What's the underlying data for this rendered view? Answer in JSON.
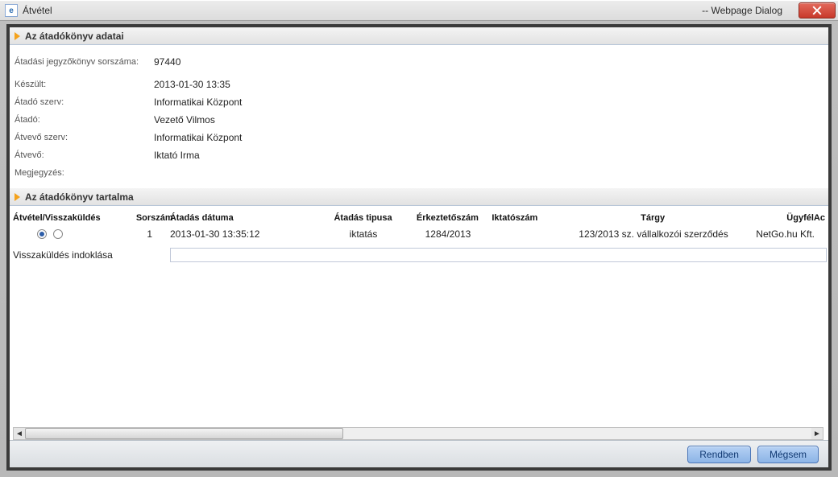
{
  "window": {
    "title": "Átvétel",
    "dialog_suffix": "-- Webpage Dialog"
  },
  "sections": {
    "head1": "Az átadókönyv adatai",
    "head2": "Az átadókönyv tartalma"
  },
  "fields": {
    "sorszam_label": "Átadási jegyzőkönyv sorszáma:",
    "sorszam_value": "97440",
    "keszult_label": "Készült:",
    "keszult_value": "2013-01-30 13:35",
    "atado_szerv_label": "Átadó szerv:",
    "atado_szerv_value": "Informatikai Központ",
    "atado_label": "Átadó:",
    "atado_value": "Vezető Vilmos",
    "atvevo_szerv_label": "Átvevő szerv:",
    "atvevo_szerv_value": "Informatikai Központ",
    "atvevo_label": "Átvevő:",
    "atvevo_value": "Iktató Irma",
    "megj_label": "Megjegyzés:",
    "megj_value": ""
  },
  "columns": {
    "atv": "Átvétel/Visszaküldés",
    "sor": "Sorszám",
    "dat": "Átadás dátuma",
    "tip": "Átadás tipusa",
    "erk": "Érkeztetőszám",
    "ikt": "Iktatószám",
    "tgy": "Tárgy",
    "ugy": "Ügyfél",
    "ac": "Ac"
  },
  "rows": [
    {
      "selected": true,
      "sorszam": "1",
      "datum": "2013-01-30 13:35:12",
      "tipus": "iktatás",
      "erkezteto": "1284/2013",
      "iktato": "",
      "targy": "123/2013 sz. vállalkozói szerződés",
      "ugyfel": "NetGo.hu Kft."
    }
  ],
  "visszakuldes": {
    "label": "Visszaküldés indoklása",
    "value": ""
  },
  "buttons": {
    "ok": "Rendben",
    "cancel": "Mégsem"
  }
}
